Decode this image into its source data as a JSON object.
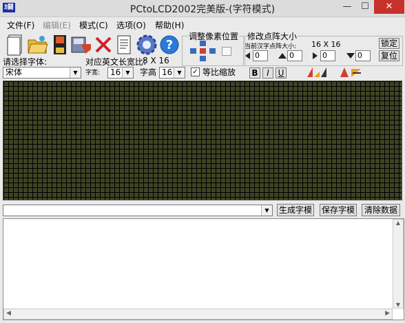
{
  "window": {
    "title": "PCtoLCD2002完美版-(字符模式)",
    "app_icon_text": "ｶ鬪",
    "minimize": "—",
    "maximize": "☐",
    "close": "✕"
  },
  "menu": [
    "文件(F)",
    "编辑(E)",
    "模式(C)",
    "选项(O)",
    "帮助(H)"
  ],
  "labels": {
    "select_font": "请选择字体:",
    "ratio": "对应英文长宽比:",
    "ratio_value": "8 X 16",
    "width": "字宽:",
    "height": "字高",
    "proportional": "等比缩放",
    "adjust_pixel": "调整像素位置",
    "modify_size": "修改点阵大小",
    "current_size": "当前汉字点阵大小:",
    "current_size_value": "16 X 16"
  },
  "font_combo": "宋体",
  "width_value": "16",
  "height_value": "16",
  "proportional_checked": "✓",
  "style_buttons": [
    "B",
    "I",
    "U"
  ],
  "spin_values": [
    "0",
    "0",
    "0",
    "0"
  ],
  "lock_button": "锁定",
  "reset_button": "复位",
  "input_value": "",
  "bottom_buttons": {
    "generate": "生成字模",
    "save": "保存字模",
    "clear": "清除数据"
  },
  "colors": {
    "grid_cell": "#3e4424",
    "grid_line": "#000000",
    "close_button": "#c7312a"
  }
}
